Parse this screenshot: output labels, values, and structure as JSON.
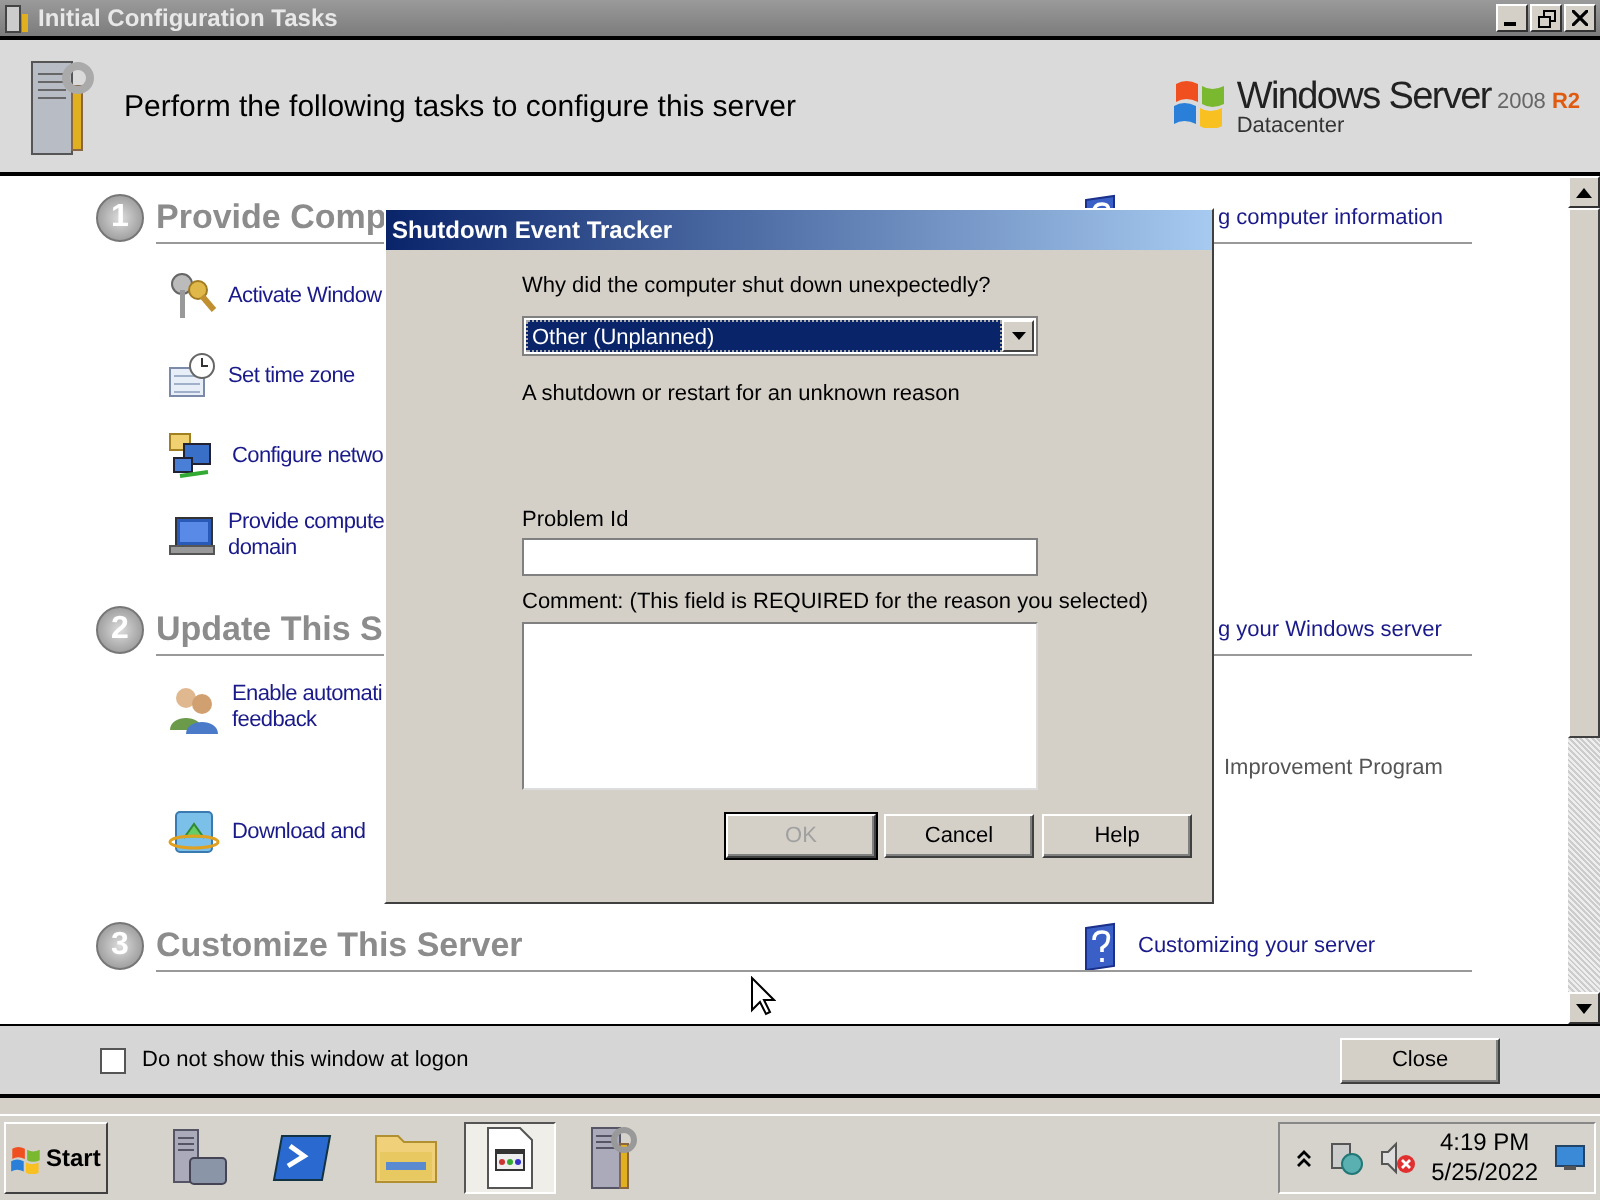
{
  "window": {
    "title": "Initial Configuration Tasks"
  },
  "header": {
    "text": "Perform the following tasks to configure this server",
    "logo": {
      "brand": "Windows Server",
      "version": "2008",
      "release": "R2",
      "edition": "Datacenter"
    }
  },
  "sections": [
    {
      "number": "1",
      "heading": "Provide Comp",
      "link": "g computer information",
      "items": [
        {
          "lines": [
            "Activate Window"
          ]
        },
        {
          "lines": [
            "Set time zone"
          ]
        },
        {
          "lines": [
            "Configure netwo"
          ]
        },
        {
          "lines": [
            "Provide compute",
            "domain"
          ]
        }
      ]
    },
    {
      "number": "2",
      "heading": "Update This S",
      "link": "g your Windows server",
      "note": "Improvement Program",
      "items": [
        {
          "lines": [
            "Enable automati",
            "feedback"
          ]
        },
        {
          "lines": [
            "Download and"
          ]
        }
      ]
    },
    {
      "number": "3",
      "heading": "Customize This Server",
      "link": "Customizing your server"
    }
  ],
  "footer": {
    "checkbox": {
      "label": "Do not show this window at logon",
      "checked": false
    },
    "close": "Close"
  },
  "dialog": {
    "title": "Shutdown Event Tracker",
    "question": "Why did the computer shut down unexpectedly?",
    "reason": "Other (Unplanned)",
    "description": "A shutdown or restart for an unknown reason",
    "problem_label": "Problem Id",
    "comment_label": "Comment: (This field is REQUIRED for the reason you selected)",
    "buttons": [
      {
        "label": "OK",
        "disabled": true
      },
      {
        "label": "Cancel",
        "disabled": false
      },
      {
        "label": "Help",
        "disabled": false
      }
    ]
  },
  "taskbar": {
    "start": "Start",
    "apps": [
      {
        "kind": "server",
        "selected": false
      },
      {
        "kind": "shell",
        "selected": false
      },
      {
        "kind": "folder",
        "selected": false
      },
      {
        "kind": "window",
        "selected": true
      },
      {
        "kind": "tools",
        "selected": false
      }
    ],
    "time": "4:19 PM",
    "date": "5/25/2022"
  }
}
